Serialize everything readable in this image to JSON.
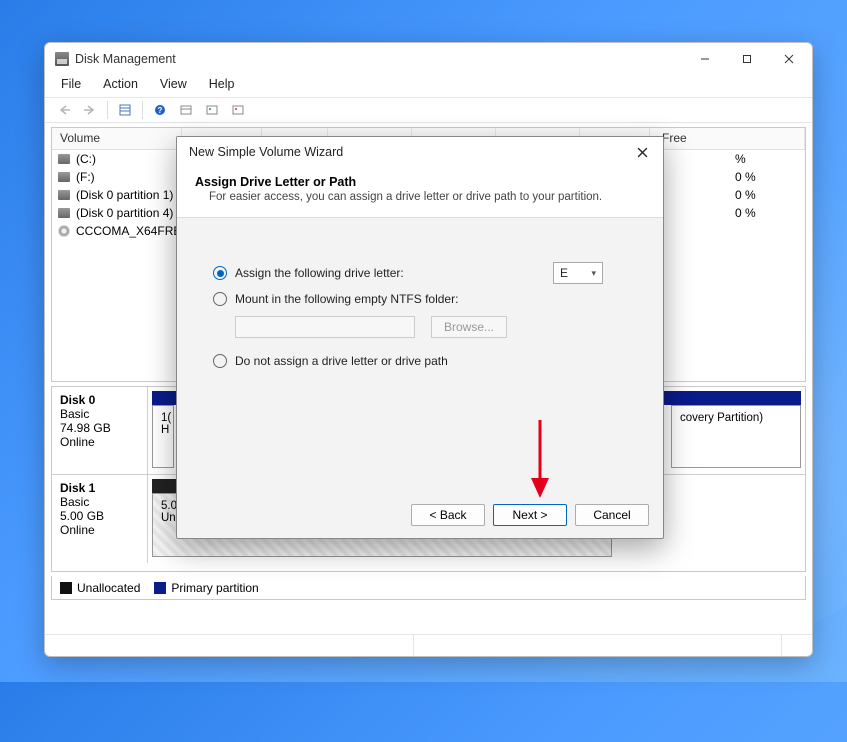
{
  "app": {
    "title": "Disk Management"
  },
  "menu": {
    "file": "File",
    "action": "Action",
    "view": "View",
    "help": "Help"
  },
  "columns": {
    "volume": "Volume",
    "free": "Free"
  },
  "volumes": {
    "v0": "(C:)",
    "v1": "(F:)",
    "v2": "(Disk 0 partition 1)",
    "v3": "(Disk 0 partition 4)",
    "v4": "CCCOMA_X64FRE..."
  },
  "free": {
    "f0": "%",
    "f1": "0 %",
    "f2": "0 %",
    "f3": "0 %"
  },
  "disk0": {
    "name": "Disk 0",
    "type": "Basic",
    "size": "74.98 GB",
    "status": "Online",
    "p1a": "1(",
    "p1b": "H",
    "p2": "covery Partition)"
  },
  "disk1": {
    "name": "Disk 1",
    "type": "Basic",
    "size": "5.00 GB",
    "status": "Online",
    "usize": "5.00 GB",
    "ulabel": "Unallocated"
  },
  "legend": {
    "unalloc": "Unallocated",
    "primary": "Primary partition"
  },
  "dialog": {
    "title": "New Simple Volume Wizard",
    "heading": "Assign Drive Letter or Path",
    "sub": "For easier access, you can assign a drive letter or drive path to your partition.",
    "opt1": "Assign the following drive letter:",
    "opt2": "Mount in the following empty NTFS folder:",
    "opt3": "Do not assign a drive letter or drive path",
    "letter": "E",
    "browse": "Browse...",
    "back": "< Back",
    "next": "Next >",
    "cancel": "Cancel"
  }
}
